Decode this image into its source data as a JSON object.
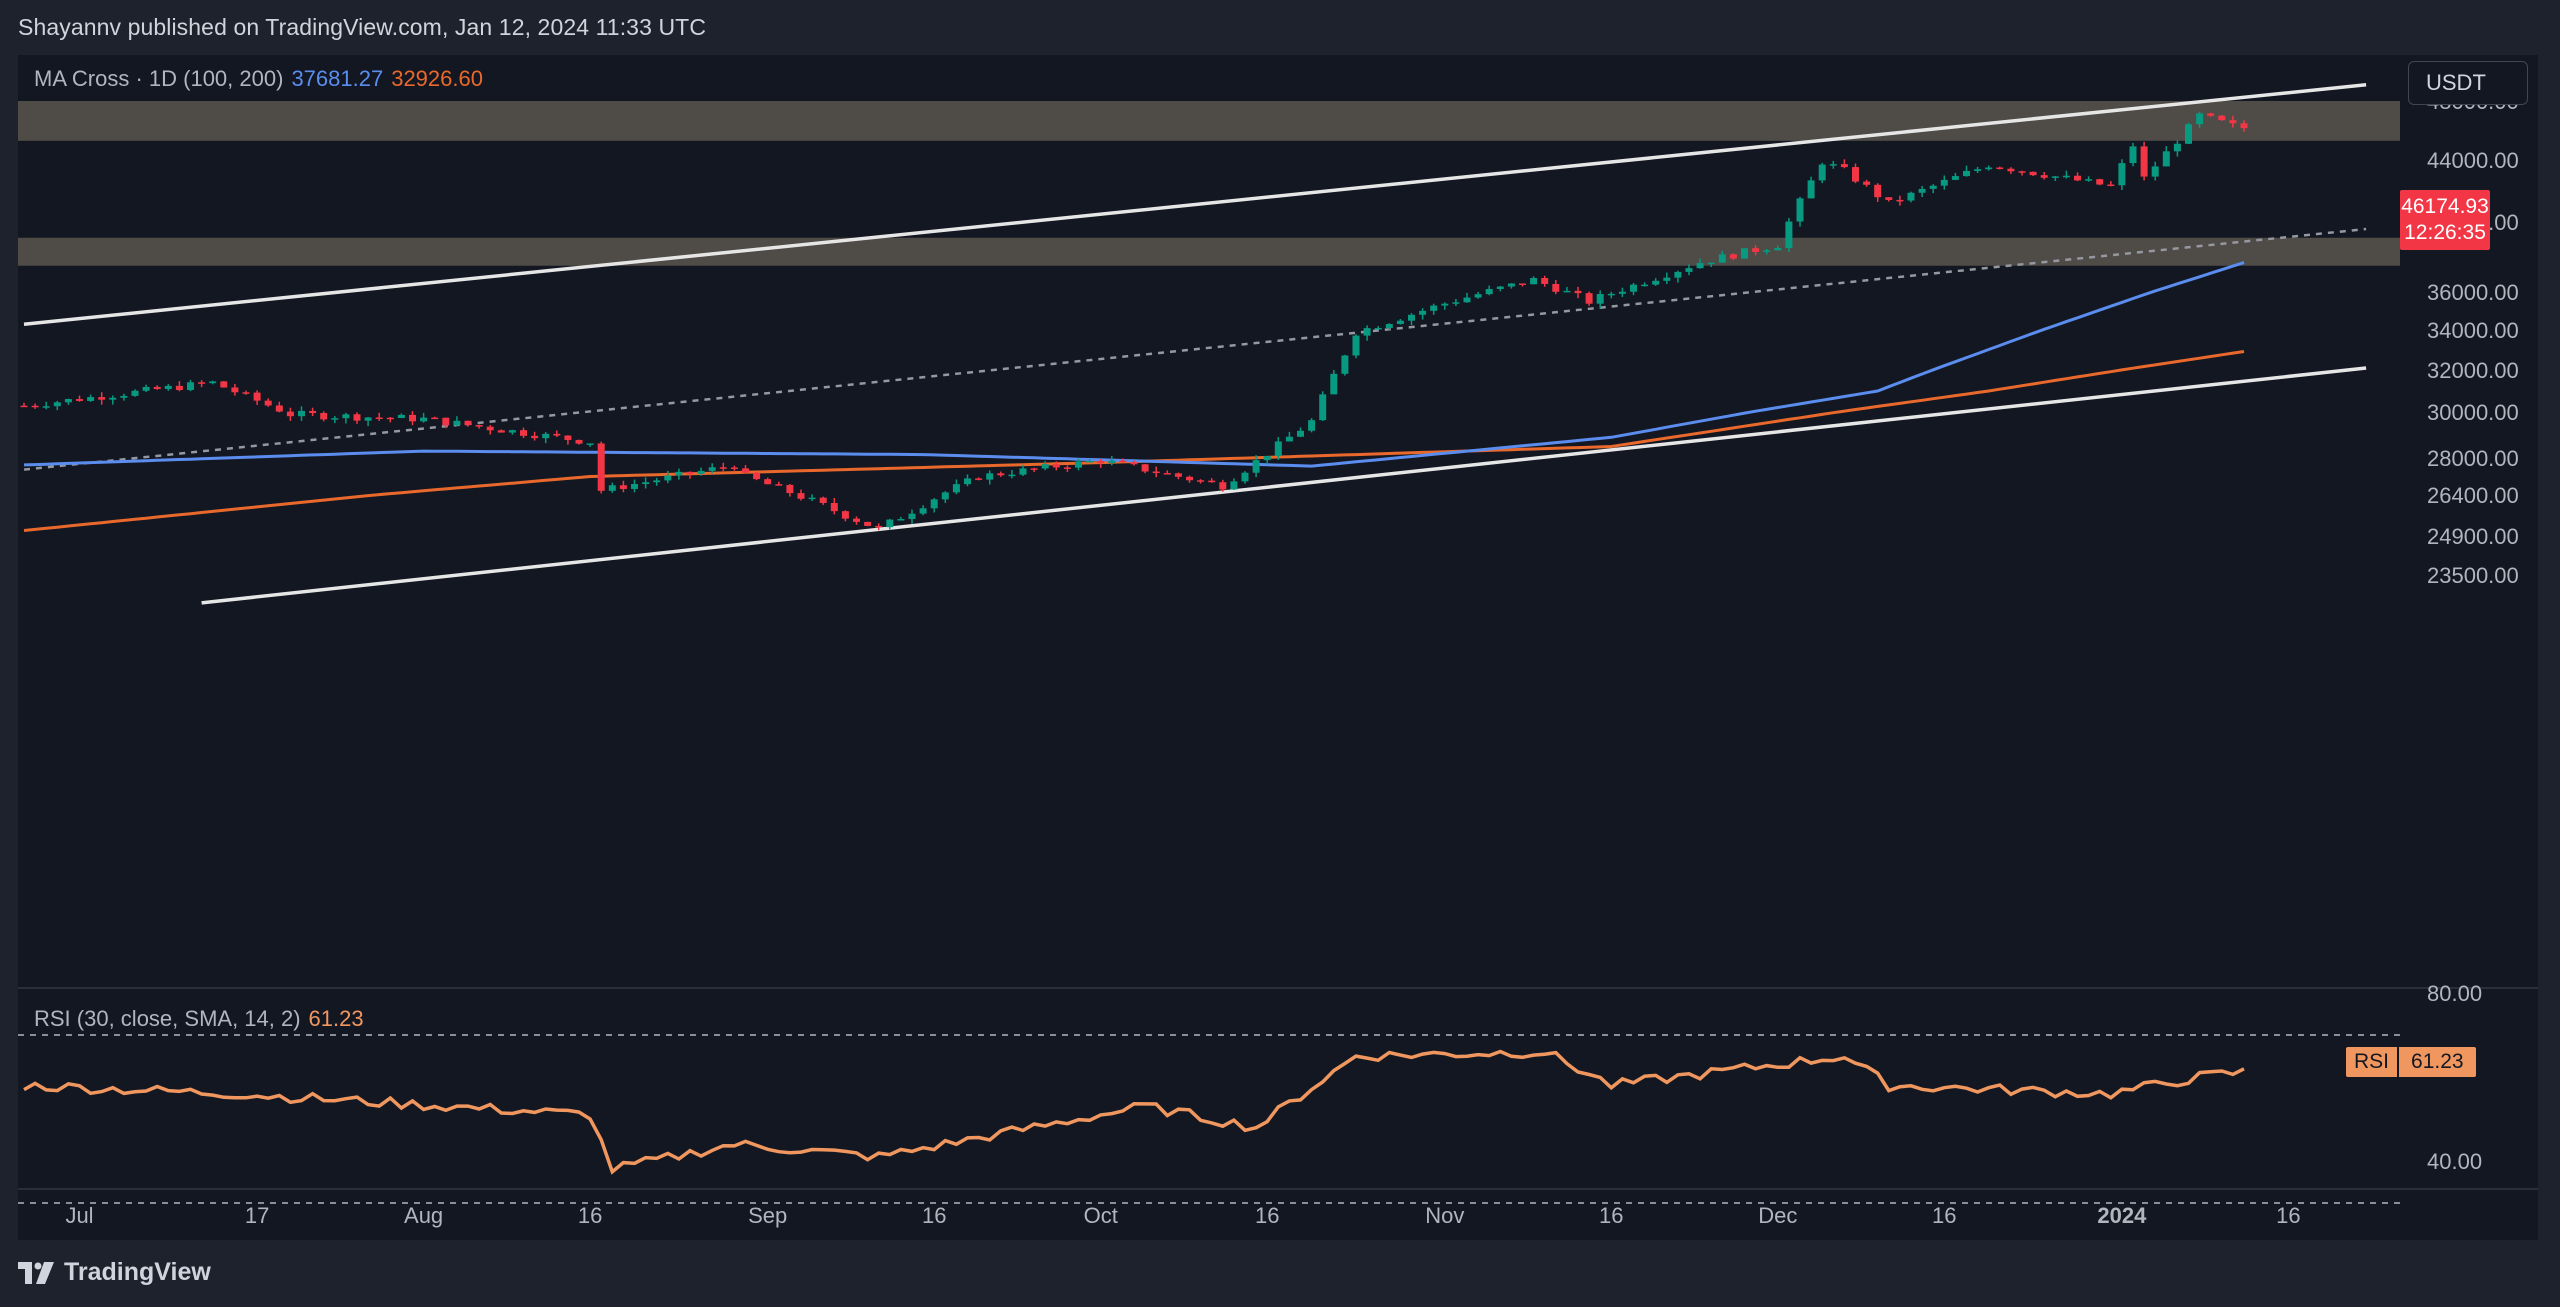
{
  "header": {
    "published_by": "Shayannv published on TradingView.com, Jan 12, 2024 11:33 UTC"
  },
  "legend": {
    "ma_label": "MA Cross · 1D (100, 200)",
    "ma100_value": "37681.27",
    "ma200_value": "32926.60",
    "rsi_label": "RSI (30, close, SMA, 14, 2)",
    "rsi_value": "61.23"
  },
  "currency_button": "USDT",
  "price_tag": {
    "price": "46174.93",
    "countdown": "12:26:35"
  },
  "rsi_tag": {
    "label": "RSI",
    "value": "61.23"
  },
  "footer": {
    "brand": "TradingView"
  },
  "colors": {
    "background": "#131722",
    "up_candle": "#089981",
    "down_candle": "#f23645",
    "ma100": "#5b8def",
    "ma200": "#e9692c",
    "rsi": "#f0975f",
    "zone": "#5a554c",
    "channel": "#e6e6e6"
  },
  "chart_data": {
    "type": "candlestick",
    "symbol_quote": "USDT",
    "y_ticks": [
      "48000.00",
      "44000.00",
      "40000.00",
      "36000.00",
      "34000.00",
      "32000.00",
      "30000.00",
      "28000.00",
      "26400.00",
      "24900.00",
      "23500.00"
    ],
    "x_ticks": [
      "Jul",
      "17",
      "Aug",
      "16",
      "Sep",
      "16",
      "Oct",
      "16",
      "Nov",
      "16",
      "Dec",
      "16",
      "2024",
      "16"
    ],
    "ohlc_anchors": [
      {
        "date": "2023-06-26",
        "close": 30300
      },
      {
        "date": "2023-07-13",
        "close": 31400
      },
      {
        "date": "2023-07-20",
        "close": 29900
      },
      {
        "date": "2023-08-01",
        "close": 29700
      },
      {
        "date": "2023-08-16",
        "close": 28700
      },
      {
        "date": "2023-08-17",
        "close": 26600
      },
      {
        "date": "2023-08-29",
        "close": 27700
      },
      {
        "date": "2023-08-30",
        "close": 27200
      },
      {
        "date": "2023-09-11",
        "close": 25150
      },
      {
        "date": "2023-09-20",
        "close": 27200
      },
      {
        "date": "2023-10-01",
        "close": 27900
      },
      {
        "date": "2023-10-12",
        "close": 26800
      },
      {
        "date": "2023-10-20",
        "close": 29600
      },
      {
        "date": "2023-10-24",
        "close": 33900
      },
      {
        "date": "2023-11-01",
        "close": 35400
      },
      {
        "date": "2023-11-09",
        "close": 36700
      },
      {
        "date": "2023-11-14",
        "close": 35500
      },
      {
        "date": "2023-11-24",
        "close": 37700
      },
      {
        "date": "2023-12-01",
        "close": 38700
      },
      {
        "date": "2023-12-05",
        "close": 43900
      },
      {
        "date": "2023-12-07",
        "close": 43300
      },
      {
        "date": "2023-12-11",
        "close": 41200
      },
      {
        "date": "2023-12-20",
        "close": 43700
      },
      {
        "date": "2023-12-31",
        "close": 42300
      },
      {
        "date": "2024-01-02",
        "close": 45000
      },
      {
        "date": "2024-01-03",
        "close": 42800
      },
      {
        "date": "2024-01-08",
        "close": 47000
      },
      {
        "date": "2024-01-11",
        "close": 46300
      },
      {
        "date": "2024-01-12",
        "close": 46175
      }
    ],
    "ma100_anchors": [
      {
        "date": "2023-06-26",
        "value": 27700
      },
      {
        "date": "2023-08-01",
        "value": 28300
      },
      {
        "date": "2023-09-15",
        "value": 28150
      },
      {
        "date": "2023-10-20",
        "value": 27650
      },
      {
        "date": "2023-11-16",
        "value": 28900
      },
      {
        "date": "2023-12-10",
        "value": 31000
      },
      {
        "date": "2024-01-12",
        "value": 37681.27
      }
    ],
    "ma200_anchors": [
      {
        "date": "2023-06-26",
        "value": 25100
      },
      {
        "date": "2023-08-16",
        "value": 27200
      },
      {
        "date": "2023-10-01",
        "value": 27800
      },
      {
        "date": "2023-11-16",
        "value": 28500
      },
      {
        "date": "2023-12-20",
        "value": 31000
      },
      {
        "date": "2024-01-12",
        "value": 32926.6
      }
    ],
    "resistance_zones": [
      {
        "low": 45300,
        "high": 48000
      },
      {
        "low": 37500,
        "high": 39100
      }
    ],
    "channel_lines": [
      {
        "name": "upper",
        "start": {
          "date": "2023-06-26",
          "price": 34300
        },
        "end": {
          "date": "2024-01-23",
          "price": 49100
        }
      },
      {
        "name": "middle",
        "start": {
          "date": "2023-06-26",
          "price": 27500
        },
        "end": {
          "date": "2024-01-23",
          "price": 39600
        }
      },
      {
        "name": "lower",
        "start": {
          "date": "2023-07-12",
          "price": 22500
        },
        "end": {
          "date": "2024-01-23",
          "price": 32100
        }
      }
    ],
    "rsi": {
      "y_ticks": [
        "80.00",
        "40.00"
      ],
      "anchors": [
        {
          "date": "2023-06-26",
          "value": 58
        },
        {
          "date": "2023-07-15",
          "value": 56
        },
        {
          "date": "2023-08-16",
          "value": 51
        },
        {
          "date": "2023-08-18",
          "value": 38
        },
        {
          "date": "2023-08-29",
          "value": 44
        },
        {
          "date": "2023-09-11",
          "value": 41
        },
        {
          "date": "2023-10-05",
          "value": 53
        },
        {
          "date": "2023-10-15",
          "value": 48
        },
        {
          "date": "2023-10-24",
          "value": 65
        },
        {
          "date": "2023-11-10",
          "value": 66
        },
        {
          "date": "2023-11-16",
          "value": 58
        },
        {
          "date": "2023-12-07",
          "value": 65
        },
        {
          "date": "2023-12-11",
          "value": 58
        },
        {
          "date": "2023-12-31",
          "value": 56
        },
        {
          "date": "2024-01-08",
          "value": 60
        },
        {
          "date": "2024-01-12",
          "value": 61.23
        }
      ]
    }
  }
}
